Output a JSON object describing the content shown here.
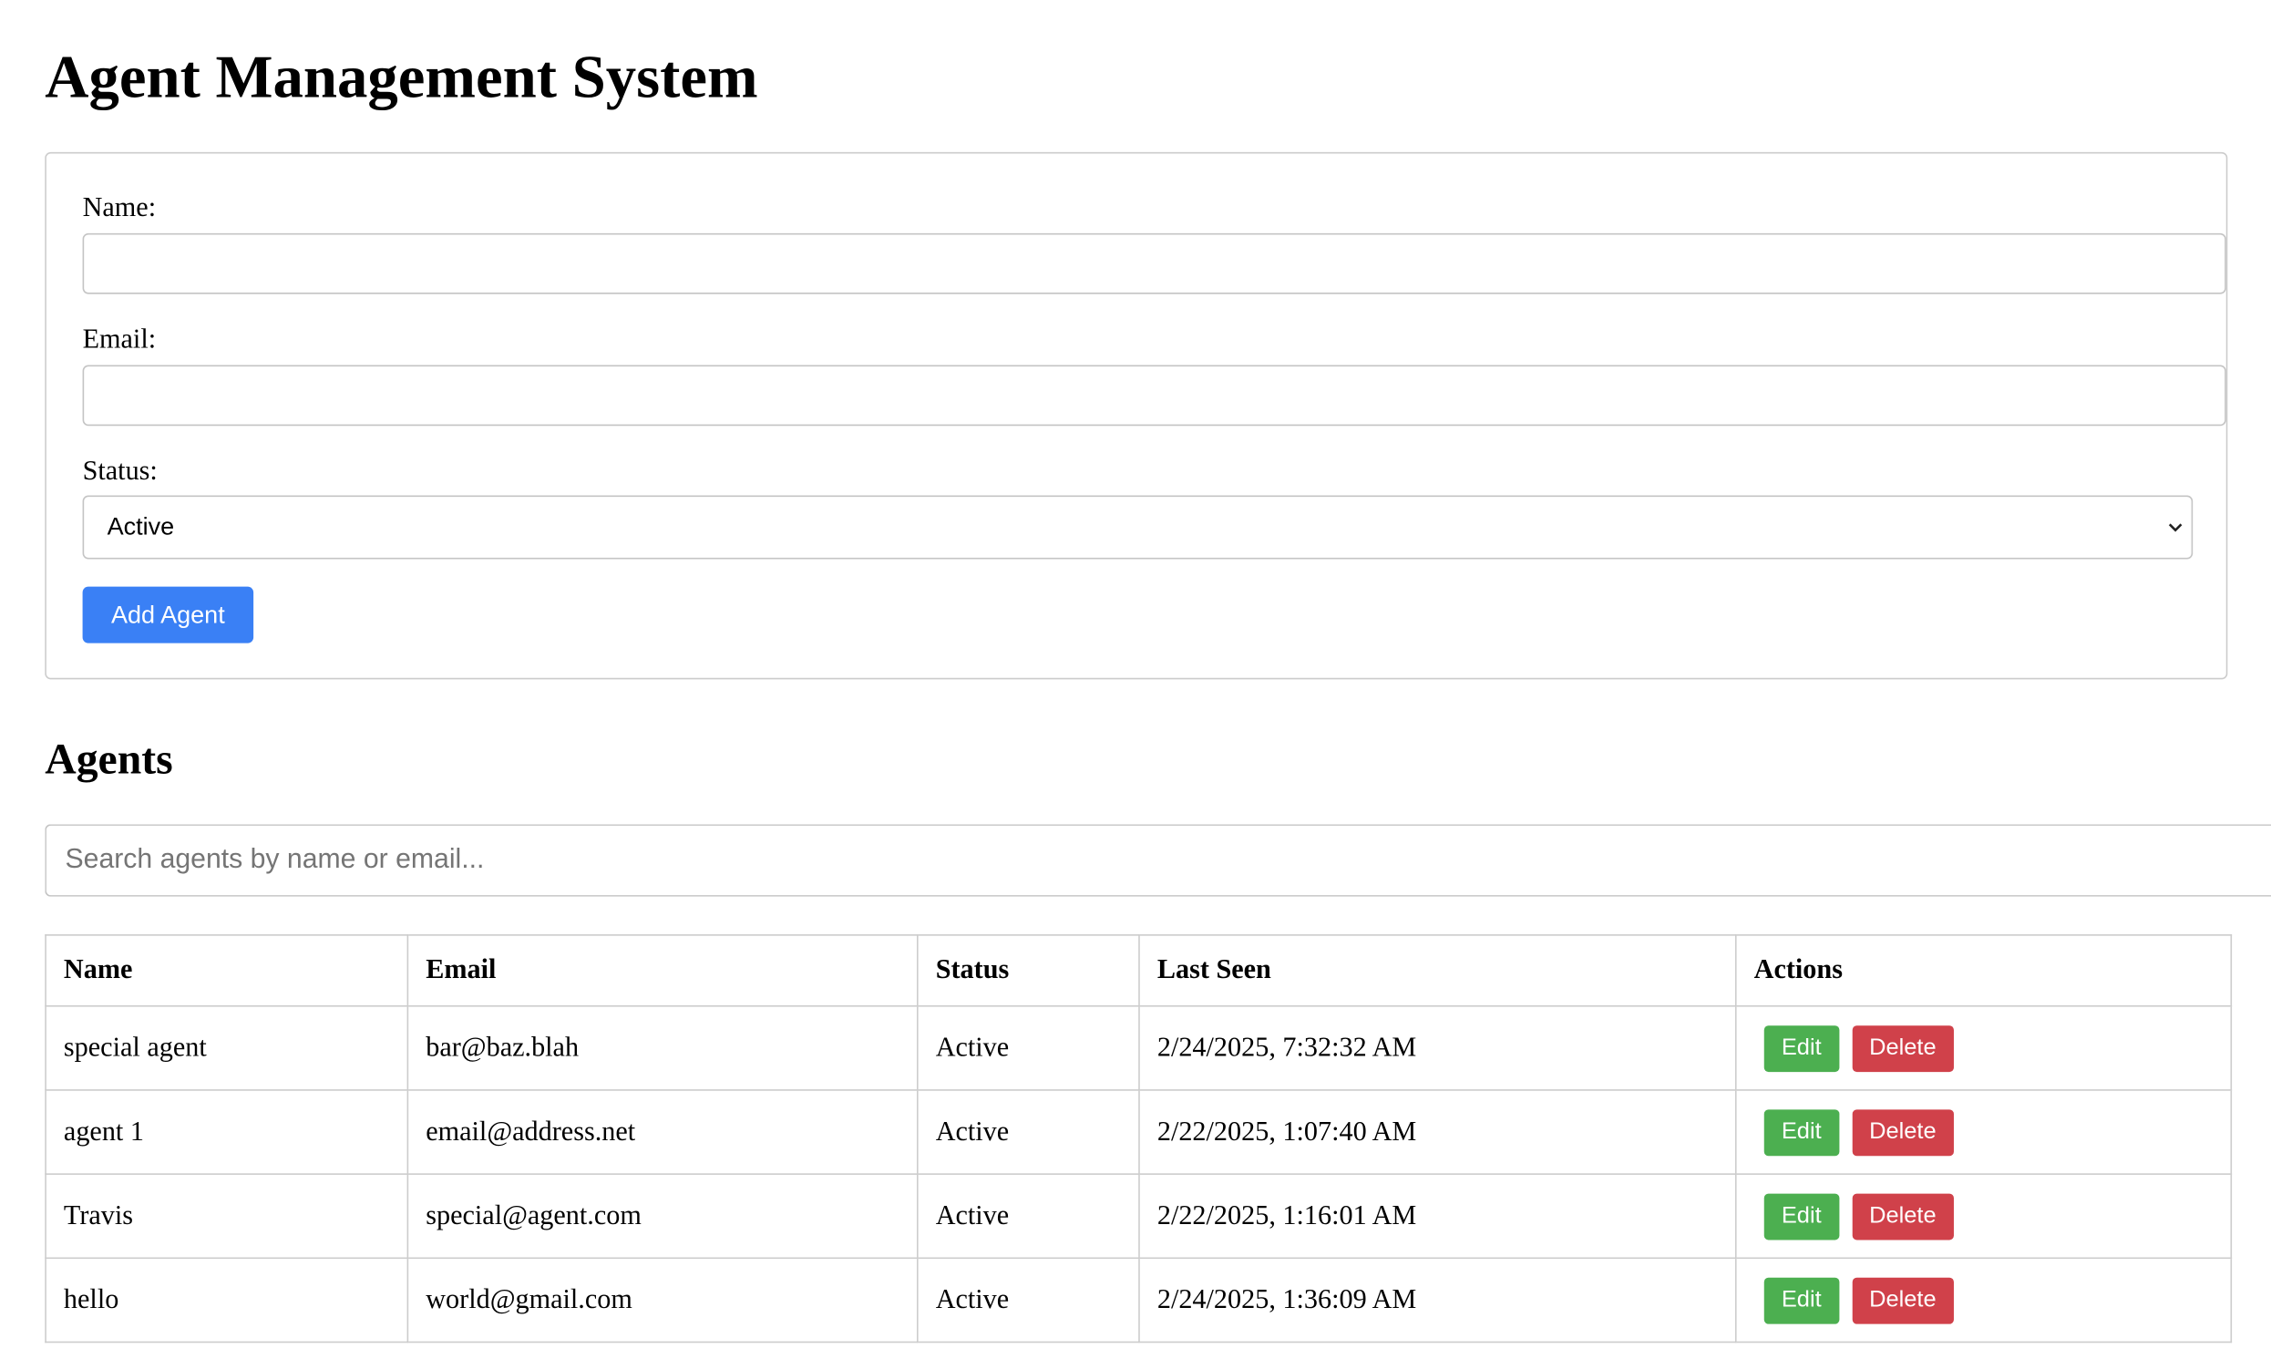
{
  "page": {
    "title": "Agent Management System"
  },
  "form": {
    "name_label": "Name:",
    "name_value": "",
    "email_label": "Email:",
    "email_value": "",
    "status_label": "Status:",
    "status_selected": "Active",
    "submit_label": "Add Agent"
  },
  "agents_section": {
    "title": "Agents",
    "search_placeholder": "Search agents by name or email...",
    "columns": [
      "Name",
      "Email",
      "Status",
      "Last Seen",
      "Actions"
    ],
    "rows": [
      {
        "name": "special agent",
        "email": "bar@baz.blah",
        "status": "Active",
        "last_seen": "2/24/2025, 7:32:32 AM"
      },
      {
        "name": "agent 1",
        "email": "email@address.net",
        "status": "Active",
        "last_seen": "2/22/2025, 1:07:40 AM"
      },
      {
        "name": "Travis",
        "email": "special@agent.com",
        "status": "Active",
        "last_seen": "2/22/2025, 1:16:01 AM"
      },
      {
        "name": "hello",
        "email": "world@gmail.com",
        "status": "Active",
        "last_seen": "2/24/2025, 1:36:09 AM"
      }
    ],
    "edit_label": "Edit",
    "delete_label": "Delete"
  },
  "colors": {
    "primary_button": "#3a80f5",
    "edit_button": "#4caf50",
    "delete_button": "#d0414a",
    "border": "#cccccc"
  },
  "icons": {
    "select_arrow": "chevron-down-icon"
  }
}
